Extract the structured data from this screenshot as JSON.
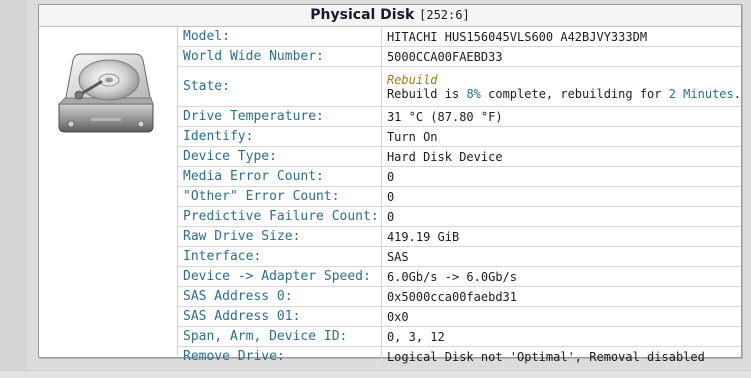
{
  "panel": {
    "title": "Physical Disk",
    "id_label": "[252:6]"
  },
  "icons": {
    "disk": "hard-disk-icon"
  },
  "colors": {
    "key_text": "#2c6e8c",
    "rebuild": "#9a7a18",
    "temperature_ok": "#2e9a2e",
    "action_link": "#7a1f8a",
    "disabled_text": "#6c6c6c"
  },
  "rows": {
    "model": {
      "label": "Model:",
      "value": "HITACHI HUS156045VLS600 A42BJVY333DM"
    },
    "wwn": {
      "label": "World Wide Number:",
      "value": "5000CCA00FAEBD33"
    },
    "state": {
      "label": "State:",
      "status": "Rebuild",
      "detail_prefix": "Rebuild is ",
      "percent": "8%",
      "detail_mid": " complete, rebuilding for ",
      "duration": "2 Minutes",
      "detail_suffix": "."
    },
    "temperature": {
      "label": "Drive Temperature:",
      "value": "31 °C (87.80 °F)"
    },
    "identify": {
      "label": "Identify:",
      "value": "Turn On"
    },
    "device_type": {
      "label": "Device Type:",
      "value": "Hard Disk Device"
    },
    "media_errors": {
      "label": "Media Error Count:",
      "value": "0"
    },
    "other_errors": {
      "label": "\"Other\" Error Count:",
      "value": "0"
    },
    "predictive_failures": {
      "label": "Predictive Failure Count:",
      "value": "0"
    },
    "raw_size": {
      "label": "Raw Drive Size:",
      "value": "419.19 GiB"
    },
    "interface": {
      "label": "Interface:",
      "value": "SAS"
    },
    "link_speed": {
      "label": "Device -> Adapter Speed:",
      "value": "6.0Gb/s -> 6.0Gb/s"
    },
    "sas0": {
      "label": "SAS Address 0:",
      "value": "0x5000cca00faebd31"
    },
    "sas1": {
      "label": "SAS Address 01:",
      "value": "0x0"
    },
    "span": {
      "label": "Span, Arm, Device ID:",
      "value": "0, 3, 12"
    },
    "remove": {
      "label": "Remove Drive:",
      "value": "Logical Disk not 'Optimal', Removal disabled"
    }
  }
}
